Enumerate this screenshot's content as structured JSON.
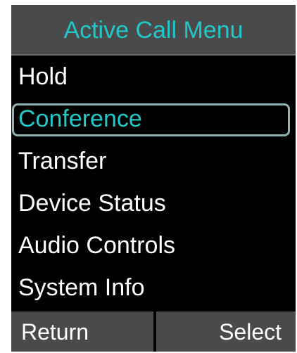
{
  "title_bar": {
    "title": "Active Call Menu"
  },
  "menu": {
    "items": [
      {
        "label": "Hold",
        "selected": false
      },
      {
        "label": "Conference",
        "selected": true
      },
      {
        "label": "Transfer",
        "selected": false
      },
      {
        "label": "Device Status",
        "selected": false
      },
      {
        "label": "Audio Controls",
        "selected": false
      },
      {
        "label": "System Info",
        "selected": false
      }
    ]
  },
  "softkeys": {
    "left_label": "Return",
    "right_label": "Select"
  },
  "colors": {
    "background": "#000000",
    "bar_gray": "#4a4a4a",
    "accent_teal": "#22c8c8",
    "selection_border": "#8fb3b3",
    "text": "#ffffff"
  }
}
